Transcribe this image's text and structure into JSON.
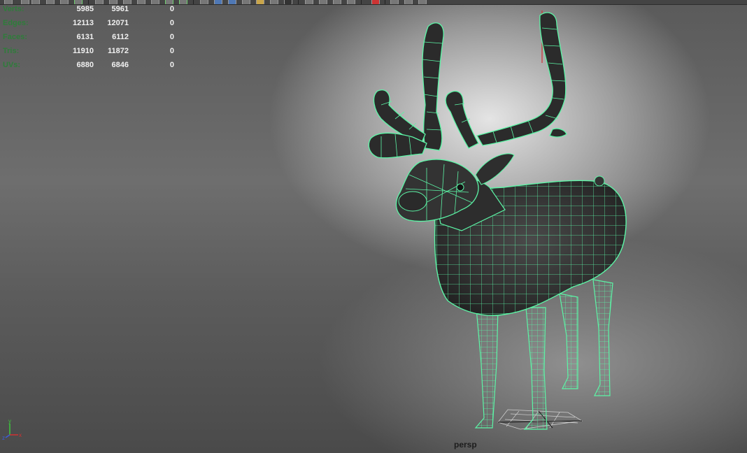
{
  "hud": {
    "rows": [
      {
        "label": "Verts:",
        "v1": "5985",
        "v2": "5961",
        "v3": "0"
      },
      {
        "label": "Edges:",
        "v1": "12113",
        "v2": "12071",
        "v3": "0"
      },
      {
        "label": "Faces:",
        "v1": "6131",
        "v2": "6112",
        "v3": "0"
      },
      {
        "label": "Tris:",
        "v1": "11910",
        "v2": "11872",
        "v3": "0"
      },
      {
        "label": "UVs:",
        "v1": "6880",
        "v2": "6846",
        "v3": "0"
      }
    ]
  },
  "camera": {
    "name": "persp"
  },
  "axis": {
    "x": "x",
    "y": "y",
    "z": "z"
  },
  "colors": {
    "wireframe": "#5cf5a6",
    "hud_label": "#2e7d3a",
    "x_axis": "#d23030",
    "y_axis": "#3cc83c",
    "z_axis": "#3c5cdc"
  }
}
